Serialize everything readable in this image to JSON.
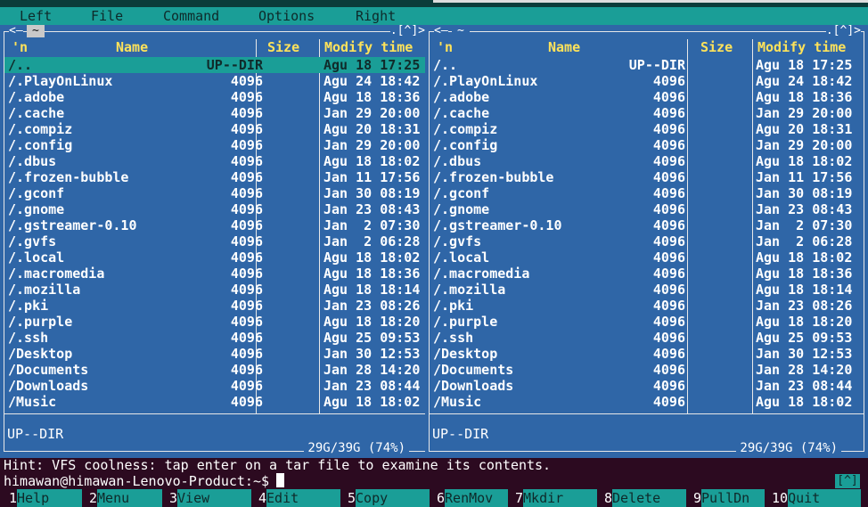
{
  "menubar": {
    "items": [
      "Left",
      "File",
      "Command",
      "Options",
      "Right"
    ]
  },
  "left_panel": {
    "path": "~",
    "sort_indicator": "'n",
    "corner_left": "<—",
    "corner_right": ".[^]>",
    "headers": {
      "name": "Name",
      "size": "Size",
      "time": "Modify time"
    },
    "status": "UP--DIR",
    "disk": "29G/39G (74%)",
    "rows": [
      {
        "name": "/..",
        "size": "UP--DIR",
        "time": "Agu 18 17:25",
        "selected": true
      },
      {
        "name": "/.PlayOnLinux",
        "size": "4096",
        "time": "Agu 24 18:42"
      },
      {
        "name": "/.adobe",
        "size": "4096",
        "time": "Agu 18 18:36"
      },
      {
        "name": "/.cache",
        "size": "4096",
        "time": "Jan 29 20:00"
      },
      {
        "name": "/.compiz",
        "size": "4096",
        "time": "Agu 20 18:31"
      },
      {
        "name": "/.config",
        "size": "4096",
        "time": "Jan 29 20:00"
      },
      {
        "name": "/.dbus",
        "size": "4096",
        "time": "Agu 18 18:02"
      },
      {
        "name": "/.frozen-bubble",
        "size": "4096",
        "time": "Jan 11 17:56"
      },
      {
        "name": "/.gconf",
        "size": "4096",
        "time": "Jan 30 08:19"
      },
      {
        "name": "/.gnome",
        "size": "4096",
        "time": "Jan 23 08:43"
      },
      {
        "name": "/.gstreamer-0.10",
        "size": "4096",
        "time": "Jan  2 07:30"
      },
      {
        "name": "/.gvfs",
        "size": "4096",
        "time": "Jan  2 06:28"
      },
      {
        "name": "/.local",
        "size": "4096",
        "time": "Agu 18 18:02"
      },
      {
        "name": "/.macromedia",
        "size": "4096",
        "time": "Agu 18 18:36"
      },
      {
        "name": "/.mozilla",
        "size": "4096",
        "time": "Agu 18 18:14"
      },
      {
        "name": "/.pki",
        "size": "4096",
        "time": "Jan 23 08:26"
      },
      {
        "name": "/.purple",
        "size": "4096",
        "time": "Agu 18 18:20"
      },
      {
        "name": "/.ssh",
        "size": "4096",
        "time": "Agu 25 09:53"
      },
      {
        "name": "/Desktop",
        "size": "4096",
        "time": "Jan 30 12:53"
      },
      {
        "name": "/Documents",
        "size": "4096",
        "time": "Jan 28 14:20"
      },
      {
        "name": "/Downloads",
        "size": "4096",
        "time": "Jan 23 08:44"
      },
      {
        "name": "/Music",
        "size": "4096",
        "time": "Agu 18 18:02"
      }
    ]
  },
  "right_panel": {
    "path": "~",
    "sort_indicator": "'n",
    "corner_left": "<—",
    "corner_right": ".[^]>",
    "headers": {
      "name": "Name",
      "size": "Size",
      "time": "Modify time"
    },
    "status": "UP--DIR",
    "disk": "29G/39G (74%)",
    "rows": [
      {
        "name": "/..",
        "size": "UP--DIR",
        "time": "Agu 18 17:25"
      },
      {
        "name": "/.PlayOnLinux",
        "size": "4096",
        "time": "Agu 24 18:42"
      },
      {
        "name": "/.adobe",
        "size": "4096",
        "time": "Agu 18 18:36"
      },
      {
        "name": "/.cache",
        "size": "4096",
        "time": "Jan 29 20:00"
      },
      {
        "name": "/.compiz",
        "size": "4096",
        "time": "Agu 20 18:31"
      },
      {
        "name": "/.config",
        "size": "4096",
        "time": "Jan 29 20:00"
      },
      {
        "name": "/.dbus",
        "size": "4096",
        "time": "Agu 18 18:02"
      },
      {
        "name": "/.frozen-bubble",
        "size": "4096",
        "time": "Jan 11 17:56"
      },
      {
        "name": "/.gconf",
        "size": "4096",
        "time": "Jan 30 08:19"
      },
      {
        "name": "/.gnome",
        "size": "4096",
        "time": "Jan 23 08:43"
      },
      {
        "name": "/.gstreamer-0.10",
        "size": "4096",
        "time": "Jan  2 07:30"
      },
      {
        "name": "/.gvfs",
        "size": "4096",
        "time": "Jan  2 06:28"
      },
      {
        "name": "/.local",
        "size": "4096",
        "time": "Agu 18 18:02"
      },
      {
        "name": "/.macromedia",
        "size": "4096",
        "time": "Agu 18 18:36"
      },
      {
        "name": "/.mozilla",
        "size": "4096",
        "time": "Agu 18 18:14"
      },
      {
        "name": "/.pki",
        "size": "4096",
        "time": "Jan 23 08:26"
      },
      {
        "name": "/.purple",
        "size": "4096",
        "time": "Agu 18 18:20"
      },
      {
        "name": "/.ssh",
        "size": "4096",
        "time": "Agu 25 09:53"
      },
      {
        "name": "/Desktop",
        "size": "4096",
        "time": "Jan 30 12:53"
      },
      {
        "name": "/Documents",
        "size": "4096",
        "time": "Jan 28 14:20"
      },
      {
        "name": "/Downloads",
        "size": "4096",
        "time": "Jan 23 08:44"
      },
      {
        "name": "/Music",
        "size": "4096",
        "time": "Agu 18 18:02"
      }
    ]
  },
  "hint": "Hint: VFS coolness: tap enter on a tar file to examine its contents.",
  "prompt": "himawan@himawan-Lenovo-Product:~$",
  "history_button": "[^]",
  "function_keys": [
    {
      "num": "1",
      "label": "Help"
    },
    {
      "num": "2",
      "label": "Menu"
    },
    {
      "num": "3",
      "label": "View"
    },
    {
      "num": "4",
      "label": "Edit"
    },
    {
      "num": "5",
      "label": "Copy"
    },
    {
      "num": "6",
      "label": "RenMov"
    },
    {
      "num": "7",
      "label": "Mkdir"
    },
    {
      "num": "8",
      "label": "Delete"
    },
    {
      "num": "9",
      "label": "PullDn"
    },
    {
      "num": "10",
      "label": "Quit"
    }
  ],
  "colors": {
    "panel_bg": "#2f66a7",
    "accent": "#1a9e97",
    "header_text": "#ffe35a",
    "terminal_bg": "#2c0a20"
  }
}
